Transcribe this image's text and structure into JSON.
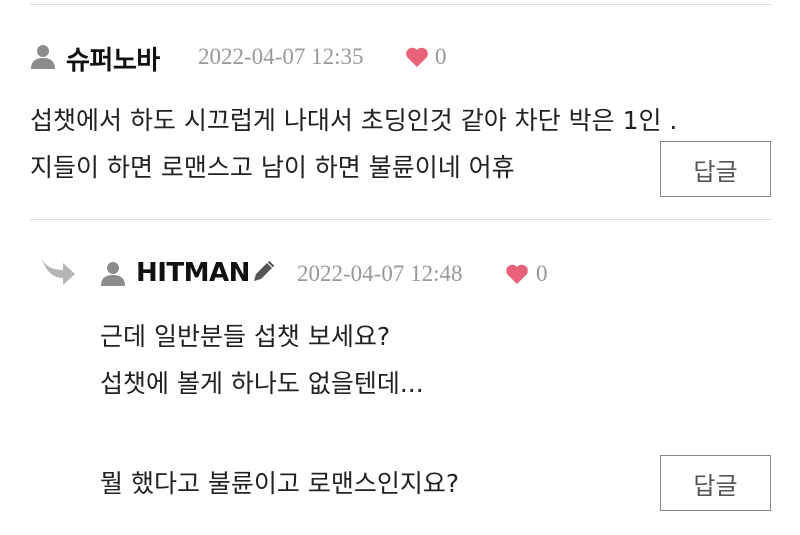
{
  "comments": [
    {
      "username": "슈퍼노바",
      "date": "2022-04-07 12:35",
      "likes": "0",
      "lines": [
        "섭챗에서 하도 시끄럽게 나대서 초딩인것 같아 차단 박은 1인 .",
        "지들이 하면 로맨스고 남이 하면 불륜이네 어휴"
      ],
      "reply_label": "답글"
    },
    {
      "username": "HITMAN",
      "date": "2022-04-07 12:48",
      "likes": "0",
      "lines": [
        "근데 일반분들 섭챗 보세요?",
        "섭챗에 볼게 하나도 없을텐데...",
        "",
        "뭘 했다고 불륜이고 로맨스인지요?"
      ],
      "reply_label": "답글"
    }
  ],
  "icons": {
    "user": "user-icon",
    "heart": "heart-icon",
    "edit": "pencil-icon",
    "reply_arrow": "reply-arrow-icon"
  },
  "colors": {
    "heart": "#e8627a",
    "icon_gray": "#8c8c8c",
    "meta_text": "#999999",
    "divider": "#dddddd"
  }
}
